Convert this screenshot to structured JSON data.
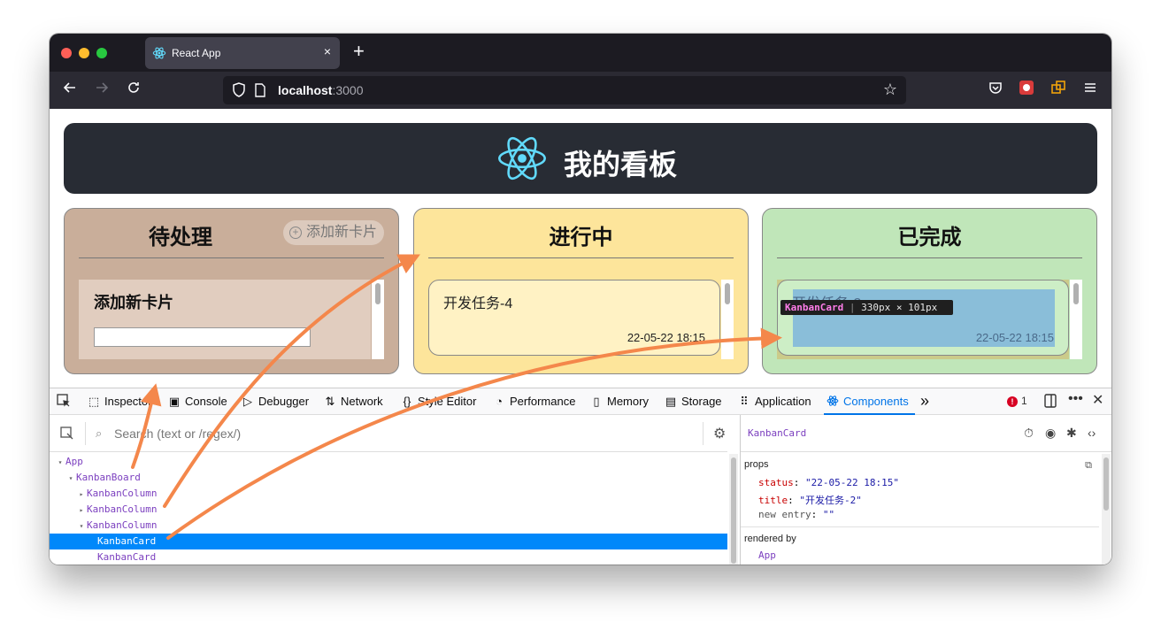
{
  "browser": {
    "tab_title": "React App",
    "tab_close": "×",
    "new_tab": "+",
    "url_host": "localhost",
    "url_port": ":3000",
    "nav_icons": [
      "back-arrow-icon",
      "forward-arrow-icon",
      "reload-icon",
      "shield-icon",
      "page-icon",
      "star-icon",
      "pocket-icon",
      "extension-icon",
      "container-icon",
      "menu-icon"
    ]
  },
  "app": {
    "title": "我的看板",
    "columns": [
      {
        "title": "待处理",
        "add_label": "添加新卡片",
        "new_card_title": "添加新卡片",
        "new_card_input": ""
      },
      {
        "title": "进行中",
        "cards": [
          {
            "title": "开发任务-4",
            "date": "22-05-22 18:15"
          }
        ]
      },
      {
        "title": "已完成",
        "cards": [
          {
            "title": "开发任务-2",
            "date": "22-05-22 18:15"
          }
        ]
      }
    ],
    "highlight_tooltip": {
      "name": "KanbanCard",
      "size": "330px × 101px"
    }
  },
  "devtools": {
    "tabs": [
      "Inspector",
      "Console",
      "Debugger",
      "Network",
      "Style Editor",
      "Performance",
      "Memory",
      "Storage",
      "Application",
      "Components"
    ],
    "active_tab": "Components",
    "error_count": "1",
    "overflow": "»",
    "search_placeholder": "Search (text or /regex/)",
    "tree": [
      {
        "label": "App",
        "depth": 0,
        "arrow": "▾"
      },
      {
        "label": "KanbanBoard",
        "depth": 1,
        "arrow": "▾"
      },
      {
        "label": "KanbanColumn",
        "depth": 2,
        "arrow": "▸"
      },
      {
        "label": "KanbanColumn",
        "depth": 2,
        "arrow": "▸"
      },
      {
        "label": "KanbanColumn",
        "depth": 2,
        "arrow": "▾"
      },
      {
        "label": "KanbanCard",
        "depth": 3,
        "arrow": "",
        "selected": true
      },
      {
        "label": "KanbanCard",
        "depth": 3,
        "arrow": ""
      }
    ],
    "selected_component": "KanbanCard",
    "props_label": "props",
    "props": [
      {
        "key": "status",
        "value": "\"22-05-22 18:15\""
      },
      {
        "key": "title",
        "value": "\"开发任务-2\""
      },
      {
        "key": "new entry",
        "value": "\"\"",
        "placeholder": true
      }
    ],
    "rendered_by_label": "rendered by",
    "rendered_by": "App"
  },
  "colors": {
    "todo": "#c9ae9a",
    "doing": "#fde59b",
    "done": "#c0e6b9",
    "annotation_arrow": "#f4874b",
    "devtools_accent": "#0074e8"
  }
}
